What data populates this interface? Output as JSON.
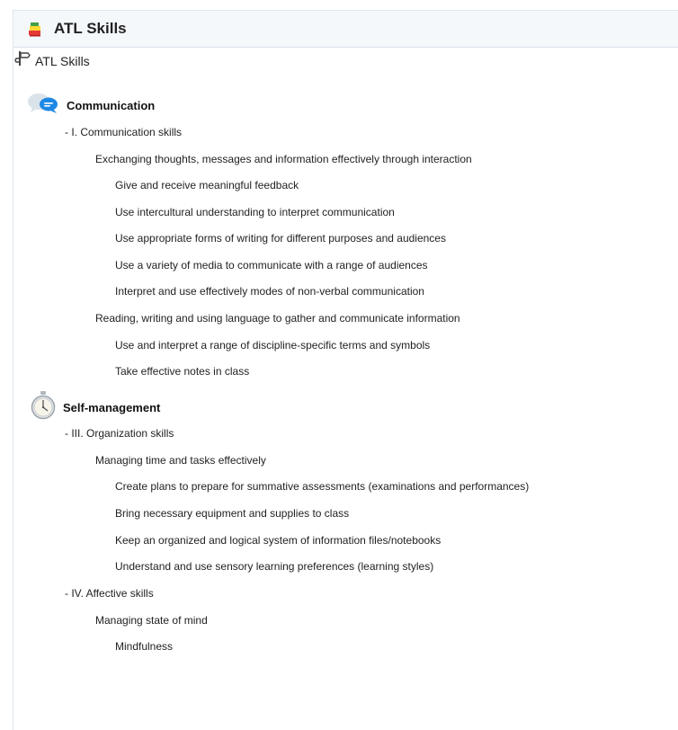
{
  "header": {
    "title": "ATL Skills",
    "icon": "books-icon"
  },
  "section": {
    "title": "ATL Skills",
    "icon": "signpost-icon"
  },
  "categories": [
    {
      "label": "Communication",
      "icon": "chat-bubbles-icon",
      "clusters": [
        {
          "label": "-  I. Communication skills",
          "groups": [
            {
              "label": "Exchanging thoughts, messages and information effectively through interaction",
              "items": [
                "Give and receive meaningful feedback",
                "Use intercultural understanding to interpret communication",
                "Use appropriate forms of writing for different purposes and audiences",
                "Use a variety of media to communicate with a range of audiences",
                "Interpret and use effectively modes of non-verbal communication"
              ]
            },
            {
              "label": "Reading, writing and using language to gather and communicate information",
              "items": [
                "Use and interpret a range of discipline-specific terms and symbols",
                "Take effective notes in class"
              ]
            }
          ]
        }
      ]
    },
    {
      "label": "Self-management",
      "icon": "clock-icon",
      "clusters": [
        {
          "label": "-  III. Organization skills",
          "groups": [
            {
              "label": "Managing time and tasks effectively",
              "items": [
                "Create plans to prepare for summative assessments (examinations and performances)",
                "Bring necessary equipment and supplies to class",
                "Keep an organized and logical system of information files/notebooks",
                "Understand and use sensory learning preferences (learning styles)"
              ]
            }
          ]
        },
        {
          "label": "-  IV. Affective skills",
          "groups": [
            {
              "label": "Managing state of mind",
              "items": [
                "Mindfulness"
              ]
            }
          ]
        }
      ]
    }
  ]
}
